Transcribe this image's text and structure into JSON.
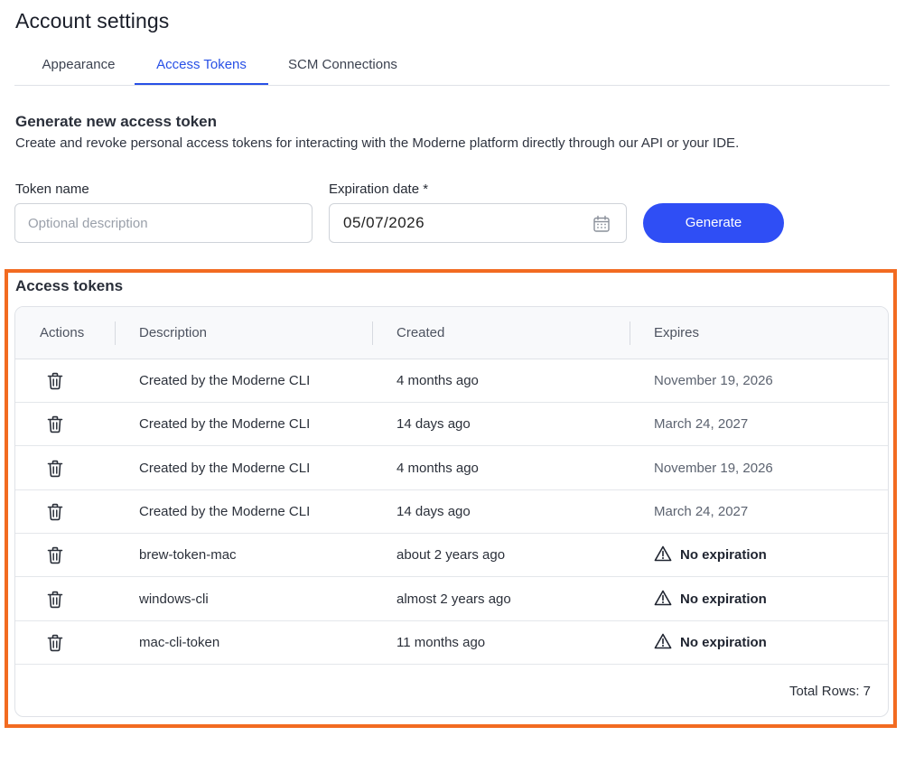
{
  "page": {
    "title": "Account settings"
  },
  "tabs": [
    {
      "label": "Appearance",
      "active": false
    },
    {
      "label": "Access Tokens",
      "active": true
    },
    {
      "label": "SCM Connections",
      "active": false
    }
  ],
  "generate": {
    "title": "Generate new access token",
    "description": "Create and revoke personal access tokens for interacting with the Moderne platform directly through our API or your IDE.",
    "token_name_label": "Token name",
    "token_name_placeholder": "Optional description",
    "token_name_value": "",
    "expiration_label": "Expiration date *",
    "expiration_value": "05/07/2026",
    "button_label": "Generate"
  },
  "tokens": {
    "title": "Access tokens",
    "columns": [
      "Actions",
      "Description",
      "Created",
      "Expires"
    ],
    "rows": [
      {
        "description": "Created by the Moderne CLI",
        "created": "4 months ago",
        "expires": "November 19, 2026",
        "no_expiration": false
      },
      {
        "description": "Created by the Moderne CLI",
        "created": "14 days ago",
        "expires": "March 24, 2027",
        "no_expiration": false
      },
      {
        "description": "Created by the Moderne CLI",
        "created": "4 months ago",
        "expires": "November 19, 2026",
        "no_expiration": false
      },
      {
        "description": "Created by the Moderne CLI",
        "created": "14 days ago",
        "expires": "March 24, 2027",
        "no_expiration": false
      },
      {
        "description": "brew-token-mac",
        "created": "about 2 years ago",
        "expires": "No expiration",
        "no_expiration": true
      },
      {
        "description": "windows-cli",
        "created": "almost 2 years ago",
        "expires": "No expiration",
        "no_expiration": true
      },
      {
        "description": "mac-cli-token",
        "created": "11 months ago",
        "expires": "No expiration",
        "no_expiration": true
      }
    ],
    "footer": "Total Rows: 7"
  },
  "icons": {
    "row_action": "trash-icon",
    "calendar": "calendar-icon",
    "warning": "warning-icon"
  },
  "colors": {
    "accent": "#2f4ef5",
    "active_tab": "#2850e6",
    "highlight": "#f26b21"
  }
}
